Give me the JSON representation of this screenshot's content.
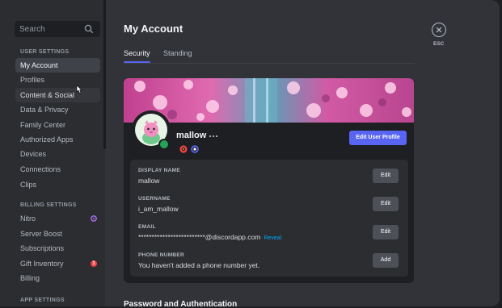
{
  "search": {
    "placeholder": "Search",
    "icon": "search-icon"
  },
  "sidebar": {
    "sections": [
      {
        "header": "USER SETTINGS"
      },
      {
        "header": "BILLING SETTINGS"
      },
      {
        "header": "APP SETTINGS"
      }
    ],
    "user_items": [
      {
        "label": "My Account"
      },
      {
        "label": "Profiles"
      },
      {
        "label": "Content & Social"
      },
      {
        "label": "Data & Privacy"
      },
      {
        "label": "Family Center"
      },
      {
        "label": "Authorized Apps"
      },
      {
        "label": "Devices"
      },
      {
        "label": "Connections"
      },
      {
        "label": "Clips"
      }
    ],
    "billing_items": [
      {
        "label": "Nitro",
        "badge_color": "#b473f5"
      },
      {
        "label": "Server Boost"
      },
      {
        "label": "Subscriptions"
      },
      {
        "label": "Gift Inventory",
        "badge_count": "1",
        "badge_color": "#f23f43"
      },
      {
        "label": "Billing"
      }
    ]
  },
  "main": {
    "title": "My Account",
    "tabs": [
      {
        "label": "Security"
      },
      {
        "label": "Standing"
      }
    ],
    "profile": {
      "username": "mallow",
      "more_icon": "ellipsis-icon",
      "edit_profile_label": "Edit User Profile",
      "status": "online",
      "status_color": "#23a55a"
    },
    "fields": [
      {
        "label": "DISPLAY NAME",
        "value": "mallow",
        "button": "Edit"
      },
      {
        "label": "USERNAME",
        "value": "i_am_mallow",
        "button": "Edit"
      },
      {
        "label": "EMAIL",
        "value": "*************************@discordapp.com",
        "reveal": "Reveal",
        "button": "Edit"
      },
      {
        "label": "PHONE NUMBER",
        "value": "You haven't added a phone number yet.",
        "button": "Add"
      }
    ],
    "next_section_title": "Password and Authentication"
  },
  "close": {
    "label": "ESC",
    "icon": "close-icon"
  },
  "colors": {
    "accent": "#5865f2",
    "link": "#00a8fc",
    "danger": "#f23f43",
    "nitro": "#b473f5"
  }
}
